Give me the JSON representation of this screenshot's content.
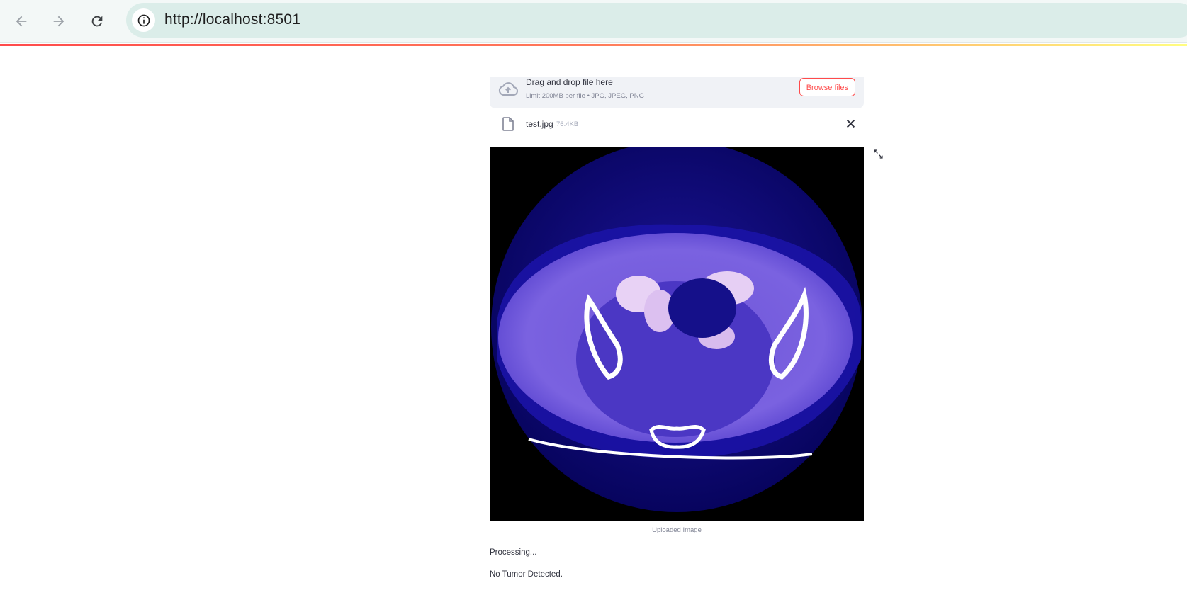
{
  "browser": {
    "url": "http://localhost:8501",
    "back_icon": "arrow-back-icon",
    "forward_icon": "arrow-forward-icon",
    "reload_icon": "reload-icon",
    "info_icon": "info-icon"
  },
  "theme": {
    "primary": "#ff4b4b",
    "text": "#31333f",
    "muted": "#808495",
    "dropzone_bg": "#f0f2f6"
  },
  "uploader": {
    "drop_title": "Drag and drop file here",
    "drop_subtitle": "Limit 200MB per file • JPG, JPEG, PNG",
    "browse_label": "Browse files",
    "file": {
      "name": "test.jpg",
      "size": "76.4KB"
    }
  },
  "image": {
    "caption": "Uploaded Image",
    "alt": "CT scan"
  },
  "status": {
    "processing": "Processing...",
    "result": "No Tumor Detected."
  }
}
